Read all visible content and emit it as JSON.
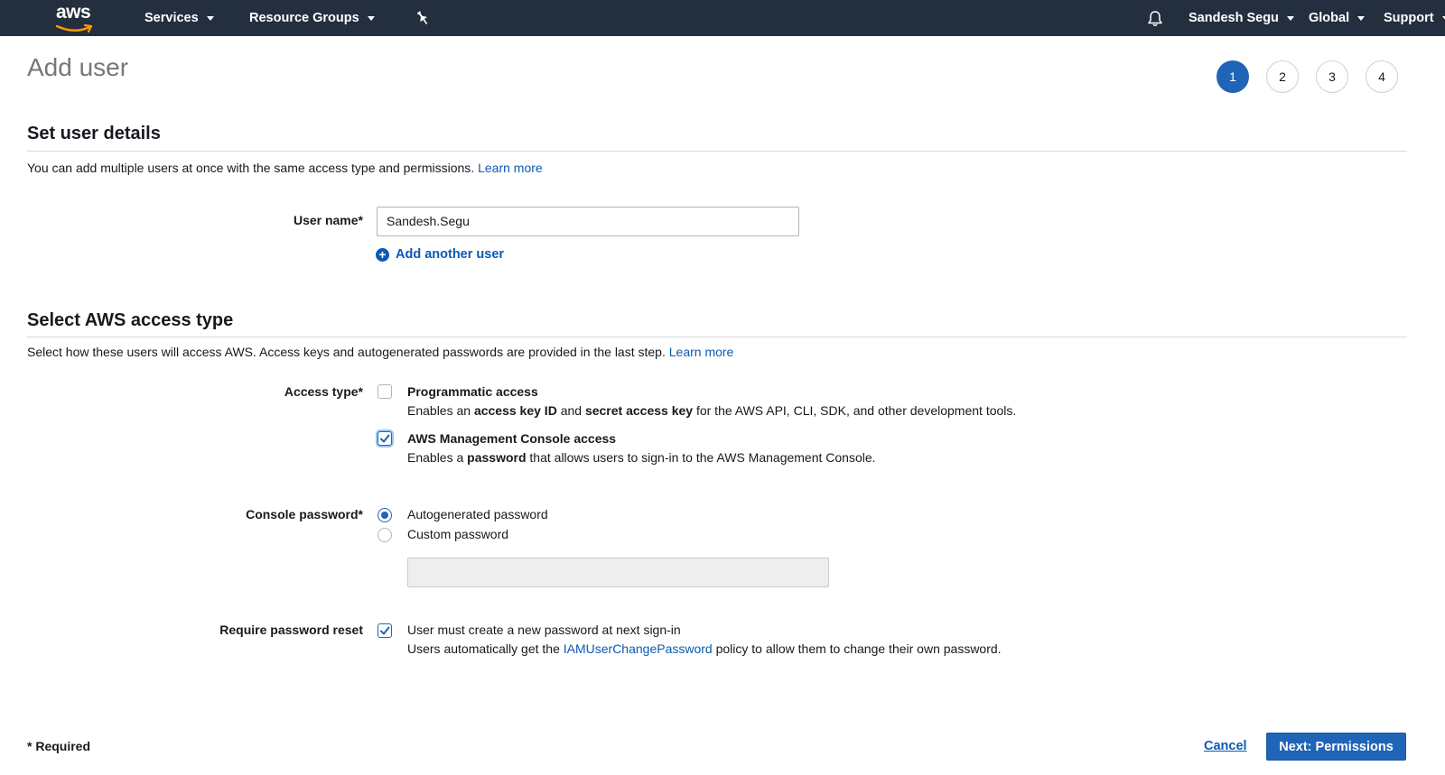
{
  "nav": {
    "logo_text": "aws",
    "services_label": "Services",
    "resource_groups_label": "Resource Groups",
    "pin_icon": "pin-icon",
    "bell_icon": "bell-icon",
    "user_label": "Sandesh Segu",
    "region_label": "Global",
    "support_label": "Support"
  },
  "page": {
    "title": "Add user",
    "steps": [
      "1",
      "2",
      "3",
      "4"
    ],
    "active_step": "1"
  },
  "user_details": {
    "title": "Set user details",
    "description": "You can add multiple users at once with the same access type and permissions.",
    "learn_more": "Learn more",
    "user_name_label": "User name*",
    "user_name_value": "Sandesh.Segu",
    "add_another_user": "Add another user"
  },
  "access_type": {
    "title": "Select AWS access type",
    "description": "Select how these users will access AWS. Access keys and autogenerated passwords are provided in the last step.",
    "learn_more": "Learn more",
    "label": "Access type*",
    "programmatic": {
      "title": "Programmatic access",
      "desc_1": "Enables an ",
      "desc_bold_1": "access key ID",
      "desc_2": " and ",
      "desc_bold_2": "secret access key",
      "desc_3": " for the AWS API, CLI, SDK, and other development tools.",
      "checked": false
    },
    "console": {
      "title": "AWS Management Console access",
      "desc_1": "Enables a ",
      "desc_bold_1": "password",
      "desc_2": " that allows users to sign-in to the AWS Management Console.",
      "checked": true
    }
  },
  "console_password": {
    "label": "Console password*",
    "autogenerated": "Autogenerated password",
    "custom": "Custom password",
    "selected": "autogenerated",
    "custom_value": ""
  },
  "password_reset": {
    "label": "Require password reset",
    "checked": true,
    "title": "User must create a new password at next sign-in",
    "desc_1": "Users automatically get the ",
    "desc_link": "IAMUserChangePassword",
    "desc_2": " policy to allow them to change their own password."
  },
  "footer": {
    "required_note": "* Required",
    "cancel_label": "Cancel",
    "next_label": "Next: Permissions"
  },
  "colors": {
    "nav_bg": "#232f3e",
    "primary": "#1f64b7",
    "link": "#0a5ab5",
    "aws_orange": "#ff9900"
  }
}
